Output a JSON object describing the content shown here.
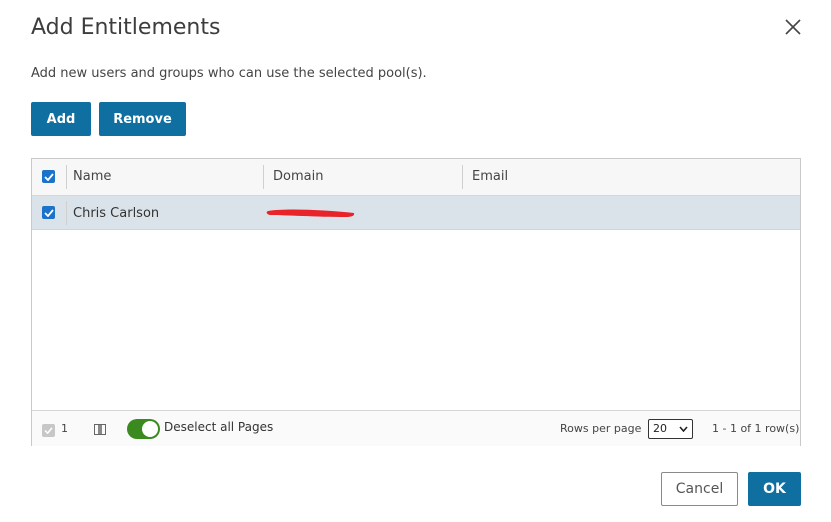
{
  "dialog": {
    "title": "Add Entitlements",
    "subtitle": "Add new users and groups who can use the selected pool(s).",
    "close_icon": "close-icon"
  },
  "toolbar": {
    "add_label": "Add",
    "remove_label": "Remove"
  },
  "grid": {
    "columns": [
      "Name",
      "Domain",
      "Email"
    ],
    "rows": [
      {
        "selected": true,
        "name": "Chris Carlson",
        "domain": "",
        "email": ""
      }
    ],
    "footer": {
      "selected_count": "1",
      "deselect_label": "Deselect all Pages",
      "deselect_on": true,
      "rows_per_page_label": "Rows per page",
      "rows_per_page_value": "20",
      "paging_text": "1 - 1 of 1 row(s)"
    }
  },
  "actions": {
    "cancel_label": "Cancel",
    "ok_label": "OK"
  },
  "colors": {
    "primary": "#0f6fa1",
    "row_selected": "#dbe3ea",
    "toggle_on": "#3a8a1f",
    "checkbox": "#1a73c9",
    "redaction": "#e8232a"
  }
}
